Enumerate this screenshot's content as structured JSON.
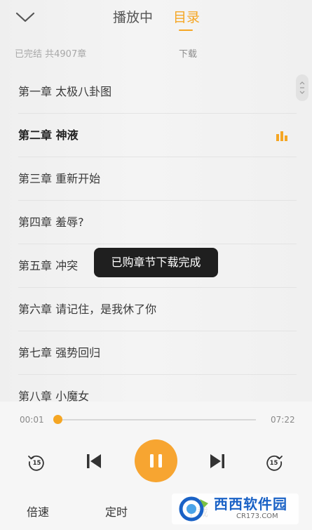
{
  "header": {
    "collapse_icon": "chevron-down-icon",
    "tabs": [
      {
        "label": "播放中",
        "active": false
      },
      {
        "label": "目录",
        "active": true
      }
    ]
  },
  "catalog": {
    "status": "已完结  共4907章",
    "download_label": "下载"
  },
  "chapters": [
    {
      "label": "第一章 太极八卦图"
    },
    {
      "label": "第二章 神液",
      "playing": true
    },
    {
      "label": "第三章 重新开始"
    },
    {
      "label": "第四章 羞辱?"
    },
    {
      "label": "第五章 冲突"
    },
    {
      "label": "第六章 请记住，是我休了你"
    },
    {
      "label": "第七章 强势回归"
    },
    {
      "label": "第八章 小魔女"
    }
  ],
  "toast": {
    "text": "已购章节下载完成"
  },
  "player": {
    "current_time": "00:01",
    "total_time": "07:22",
    "progress_fraction": 0.002,
    "rewind_seconds": "15",
    "forward_seconds": "15",
    "icons": [
      "rewind-15-icon",
      "previous-icon",
      "pause-icon",
      "next-icon",
      "forward-15-icon"
    ]
  },
  "bottom_bar": {
    "speed_label": "倍速",
    "timer_label": "定时",
    "download_label": "下载"
  },
  "watermark": {
    "main_text": "西西软件园",
    "sub_text": "CR173.COM"
  },
  "colors": {
    "accent": "#f5a623",
    "toast_bg": "#1f1f1f",
    "watermark_blue": "#1a62c6"
  }
}
